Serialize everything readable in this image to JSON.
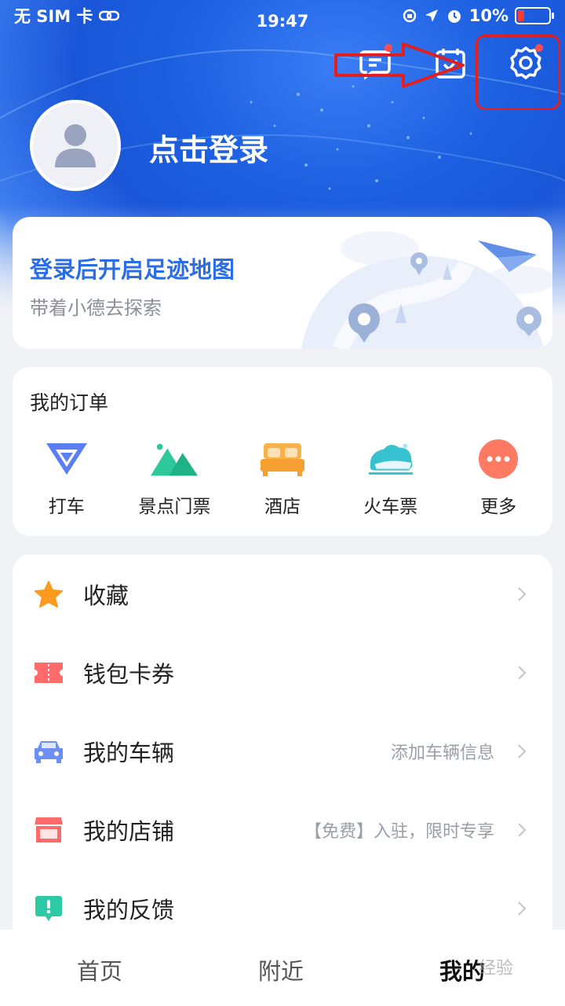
{
  "status_bar": {
    "carrier": "无 SIM 卡",
    "time": "19:47",
    "battery": "10%"
  },
  "header": {
    "login_prompt": "点击登录",
    "icons": [
      "message-icon",
      "checkin-icon",
      "settings-icon"
    ]
  },
  "footprint": {
    "title": "登录后开启足迹地图",
    "subtitle": "带着小德去探索"
  },
  "orders": {
    "title": "我的订单",
    "items": [
      {
        "label": "打车",
        "icon": "taxi-icon"
      },
      {
        "label": "景点门票",
        "icon": "scenic-ticket-icon"
      },
      {
        "label": "酒店",
        "icon": "hotel-icon"
      },
      {
        "label": "火车票",
        "icon": "train-ticket-icon"
      },
      {
        "label": "更多",
        "icon": "more-icon"
      }
    ]
  },
  "menu": {
    "items": [
      {
        "label": "收藏",
        "hint": "",
        "icon": "star-icon"
      },
      {
        "label": "钱包卡券",
        "hint": "",
        "icon": "ticket-icon"
      },
      {
        "label": "我的车辆",
        "hint": "添加车辆信息",
        "icon": "car-icon"
      },
      {
        "label": "我的店铺",
        "hint": "【免费】入驻，限时专享",
        "icon": "shop-icon"
      },
      {
        "label": "我的反馈",
        "hint": "",
        "icon": "feedback-icon"
      }
    ]
  },
  "tabbar": {
    "tabs": [
      {
        "label": "首页"
      },
      {
        "label": "附近"
      },
      {
        "label": "我的"
      }
    ]
  },
  "watermark": "经验",
  "colors": {
    "accent": "#2b6de6",
    "annotation": "#e02020",
    "badge": "#ff4d4f"
  }
}
